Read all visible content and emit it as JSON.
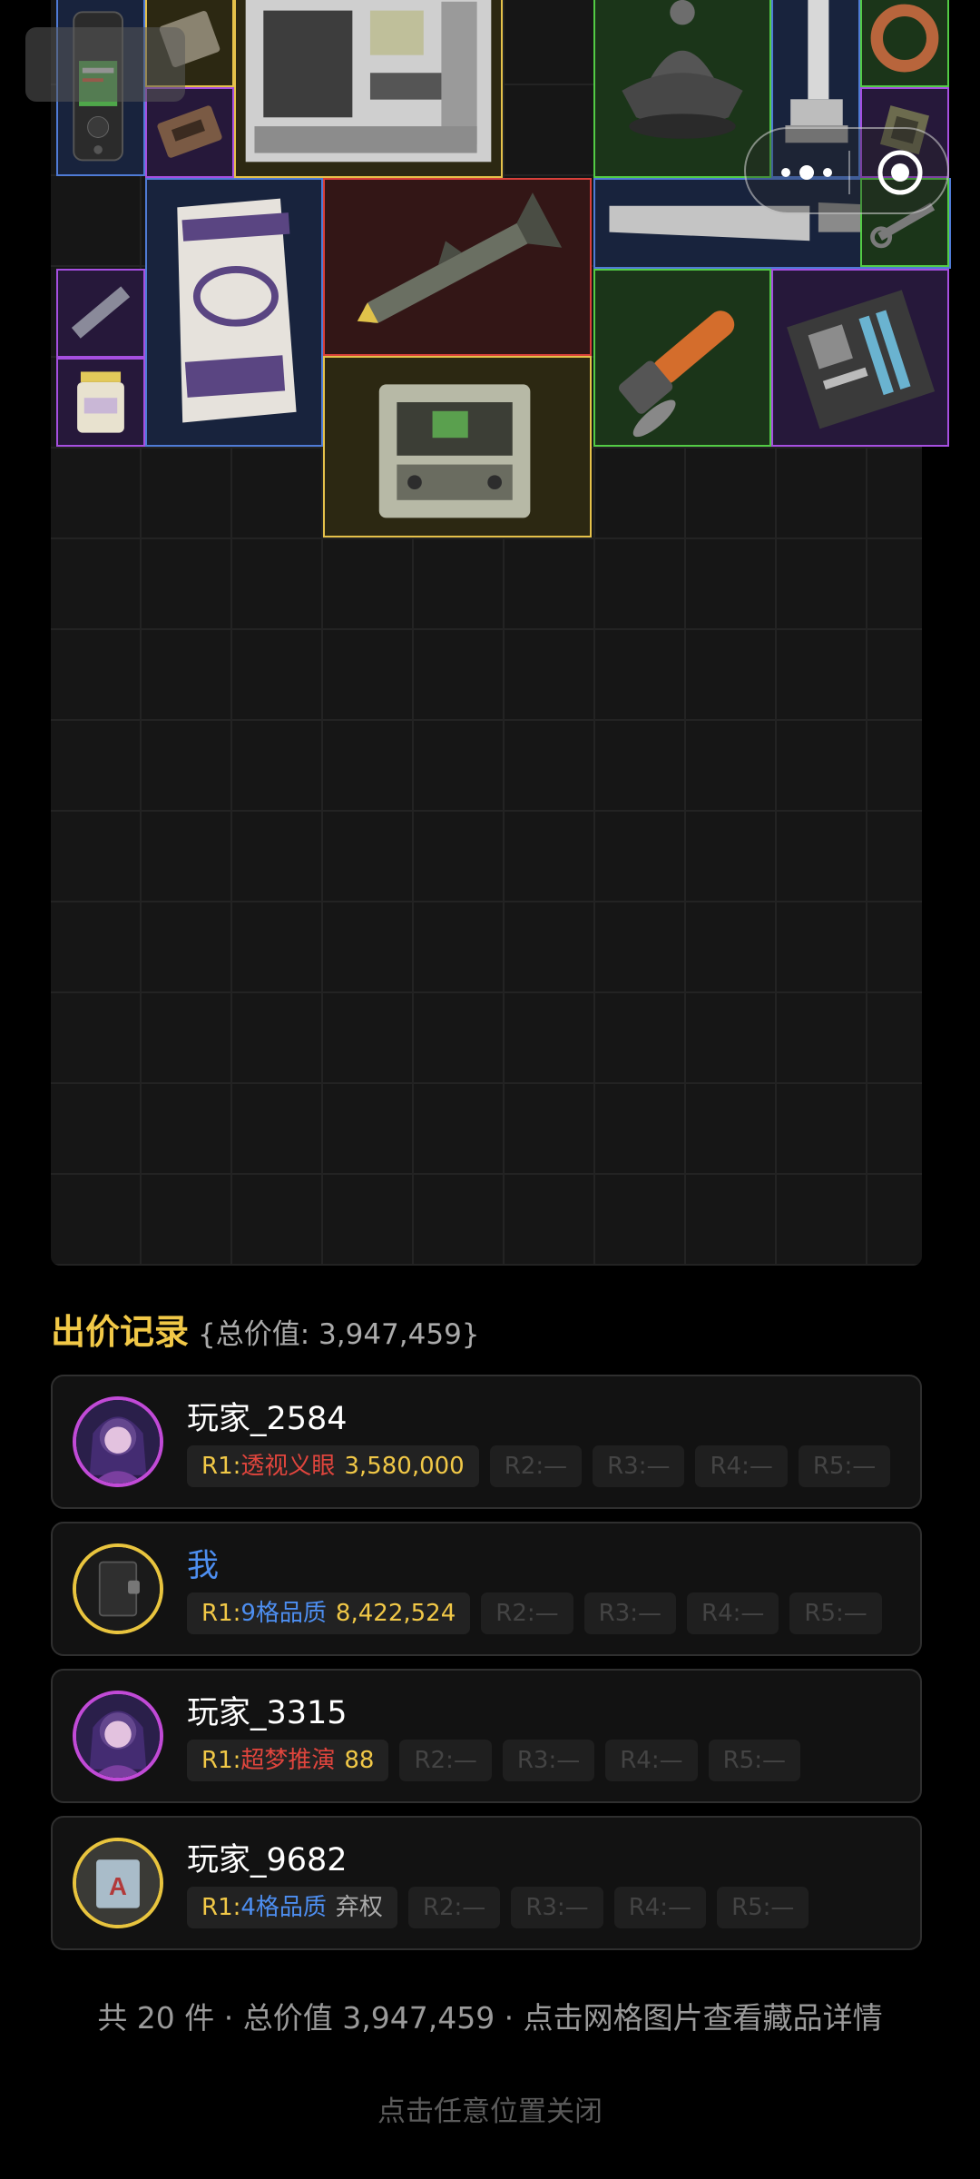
{
  "bid_section": {
    "title": "出价记录",
    "total_text": "{总价值: 3,947,459}"
  },
  "bids": [
    {
      "player": "玩家_2584",
      "avatar": "cyber-girl-avatar",
      "rounds": [
        {
          "label": "R1:",
          "item": "透视义眼",
          "item_color": "red",
          "amount": "3,580,000"
        },
        {
          "label": "R2:—"
        },
        {
          "label": "R3:—"
        },
        {
          "label": "R4:—"
        },
        {
          "label": "R5:—"
        }
      ]
    },
    {
      "player": "我",
      "avatar": "notebook-avatar",
      "rounds": [
        {
          "label": "R1:",
          "item": "9格品质",
          "item_color": "blue",
          "amount": "8,422,524"
        },
        {
          "label": "R2:—"
        },
        {
          "label": "R3:—"
        },
        {
          "label": "R4:—"
        },
        {
          "label": "R5:—"
        }
      ]
    },
    {
      "player": "玩家_3315",
      "avatar": "cyber-girl-avatar",
      "rounds": [
        {
          "label": "R1:",
          "item": "超梦推演",
          "item_color": "red",
          "amount": "88"
        },
        {
          "label": "R2:—"
        },
        {
          "label": "R3:—"
        },
        {
          "label": "R4:—"
        },
        {
          "label": "R5:—"
        }
      ]
    },
    {
      "player": "玩家_9682",
      "avatar": "patch-A-avatar",
      "rounds": [
        {
          "label": "R1:",
          "item": "4格品质",
          "item_color": "blue",
          "amount": "弃权"
        },
        {
          "label": "R2:—"
        },
        {
          "label": "R3:—"
        },
        {
          "label": "R4:—"
        },
        {
          "label": "R5:—"
        }
      ]
    }
  ],
  "summary": "共 20 件 · 总价值 3,947,459 · 点击网格图片查看藏品详情",
  "close_hint": "点击任意位置关闭",
  "colors": {
    "accent_gold": "#f1c847",
    "accent_blue": "#4d8ef0",
    "accent_red": "#e0453d",
    "rarity_purple": "#a64fe0",
    "rarity_gold": "#e5c14a",
    "rarity_green": "#53cc45",
    "rarity_red": "#d8403a",
    "rarity_blue": "#4f7bd6"
  }
}
